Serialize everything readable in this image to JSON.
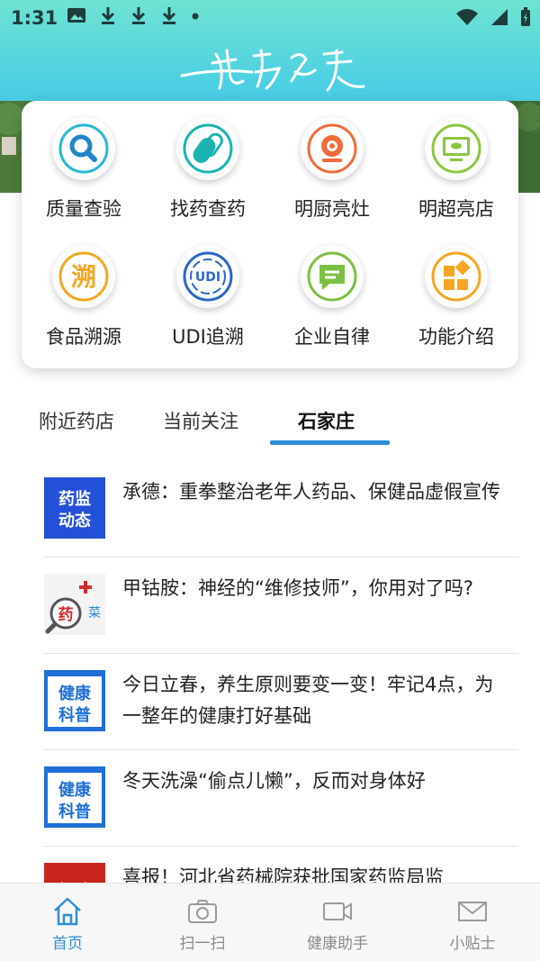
{
  "status_bar": {
    "time": "1:31"
  },
  "header": {
    "logo_text": "药安食美"
  },
  "quick_actions": [
    {
      "label": "质量查验",
      "icon": "search-icon",
      "color": "#2ab7d6"
    },
    {
      "label": "找药查药",
      "icon": "pills-icon",
      "color": "#1ab3b0"
    },
    {
      "label": "明厨亮灶",
      "icon": "webcam-icon",
      "color": "#f26b3a"
    },
    {
      "label": "明超亮店",
      "icon": "monitor-icon",
      "color": "#8cc63f"
    },
    {
      "label": "食品溯源",
      "icon": "trace-char-icon",
      "glyph": "溯",
      "color": "#f5a623"
    },
    {
      "label": "UDI追溯",
      "icon": "udi-icon",
      "glyph": "UDI",
      "color": "#2b67c3"
    },
    {
      "label": "企业自律",
      "icon": "message-icon",
      "color": "#7bc043"
    },
    {
      "label": "功能介绍",
      "icon": "grid-blocks-icon",
      "color": "#f5a623"
    }
  ],
  "tabs": [
    {
      "label": "附近药店",
      "active": false
    },
    {
      "label": "当前关注",
      "active": false
    },
    {
      "label": "石家庄",
      "active": true
    }
  ],
  "news": [
    {
      "title": "承德：重拳整治老年人药品、保健品虚假宣传",
      "thumb_text": "药监动态"
    },
    {
      "title": "甲钴胺：神经的“维修技师”，你用对了吗?",
      "thumb_text": "药"
    },
    {
      "title": "今日立春，养生原则要变一变！牢记4点，为一整年的健康打好基础",
      "thumb_text": "健康科普"
    },
    {
      "title": "冬天洗澡“偷点儿懒”，反而对身体好",
      "thumb_text": "健康科普"
    },
    {
      "title": "喜报！河北省药械院获批国家药监局监",
      "thumb_text": ""
    }
  ],
  "bottom_nav": [
    {
      "label": "首页",
      "icon": "home-icon",
      "active": true
    },
    {
      "label": "扫一扫",
      "icon": "camera-icon",
      "active": false
    },
    {
      "label": "健康助手",
      "icon": "video-icon",
      "active": false
    },
    {
      "label": "小贴士",
      "icon": "mail-icon",
      "active": false
    }
  ],
  "colors": {
    "accent": "#2f8fd8",
    "header_top": "#6fe3d2",
    "header_bottom": "#2fb0ea"
  }
}
